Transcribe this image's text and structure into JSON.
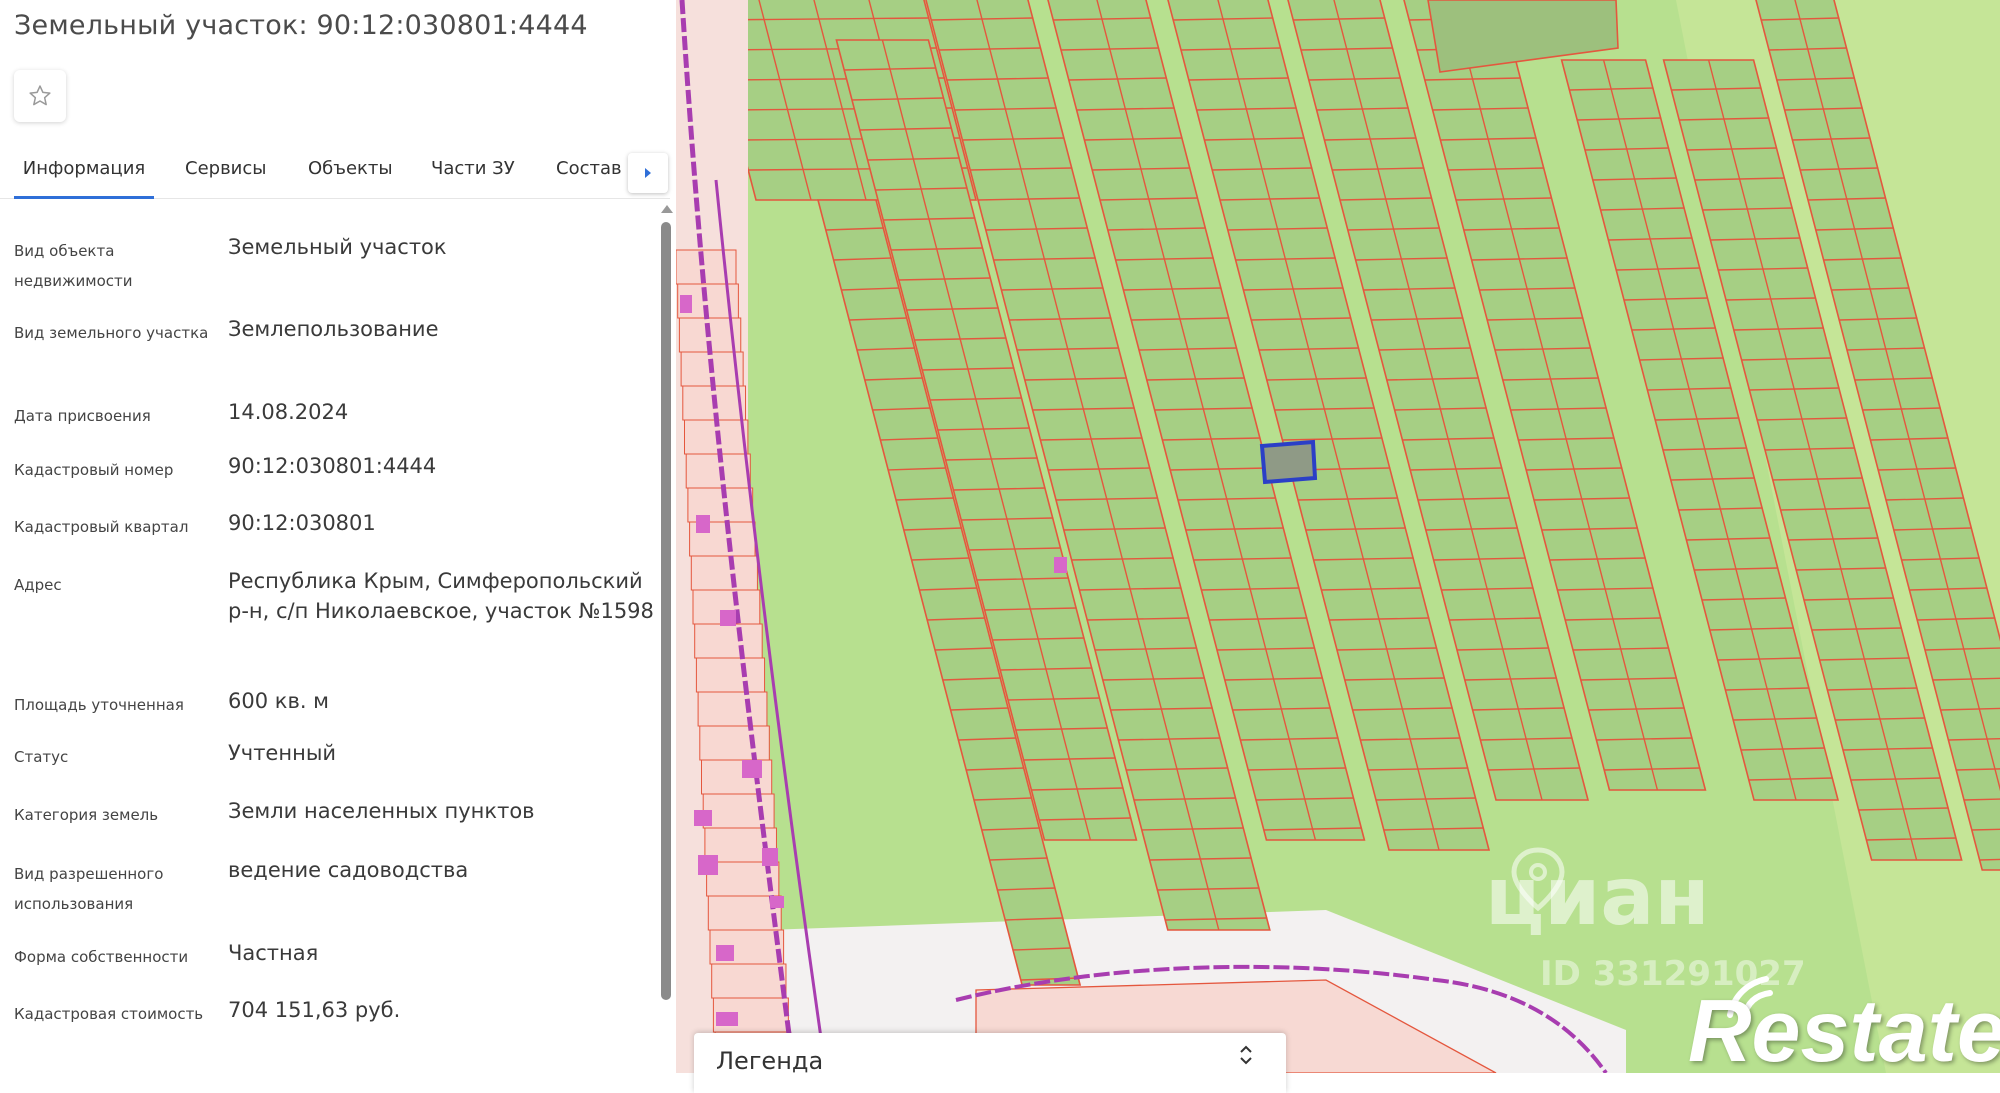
{
  "title": "Земельный участок: 90:12:030801:4444",
  "tabs": [
    {
      "label": "Информация",
      "active": true
    },
    {
      "label": "Сервисы",
      "active": false
    },
    {
      "label": "Объекты",
      "active": false
    },
    {
      "label": "Части ЗУ",
      "active": false
    },
    {
      "label": "Состав",
      "active": false
    }
  ],
  "info": [
    {
      "label": "Вид объекта недвижимости",
      "value": "Земельный участок"
    },
    {
      "label": "Вид земельного участка",
      "value": "Землепользование"
    },
    {
      "label": "Дата присвоения",
      "value": "14.08.2024"
    },
    {
      "label": "Кадастровый номер",
      "value": "90:12:030801:4444"
    },
    {
      "label": "Кадастровый квартал",
      "value": "90:12:030801"
    },
    {
      "label": "Адрес",
      "value": "Республика Крым, Симферопольский р-н, с/п Николаевское, участок №1598"
    },
    {
      "label": "Площадь уточненная",
      "value": "600 кв. м"
    },
    {
      "label": "Статус",
      "value": "Учтенный"
    },
    {
      "label": "Категория земель",
      "value": "Земли населенных пунктов"
    },
    {
      "label": "Вид разрешенного использования",
      "value": "ведение садоводства"
    },
    {
      "label": "Форма собственности",
      "value": "Частная"
    },
    {
      "label": "Кадастровая стоимость",
      "value": "704 151,63 руб."
    }
  ],
  "legend": {
    "title": "Легенда"
  },
  "watermarks": {
    "cian": "циан",
    "cian_id": "ID 331291027",
    "brand": "Restate"
  },
  "icons": {
    "favorite": "star-icon",
    "tabs_more": "chevron-right-icon",
    "legend_toggle": "chevron-up-down-icon"
  },
  "colors": {
    "accent": "#2f6fd8",
    "parcel_border": "#e4573e",
    "parcel_fill": "#a6cf84",
    "field": "#b7e08f",
    "selected_parcel": "#2b3fc7",
    "road": "#a83db0",
    "building": "#d767c9"
  }
}
